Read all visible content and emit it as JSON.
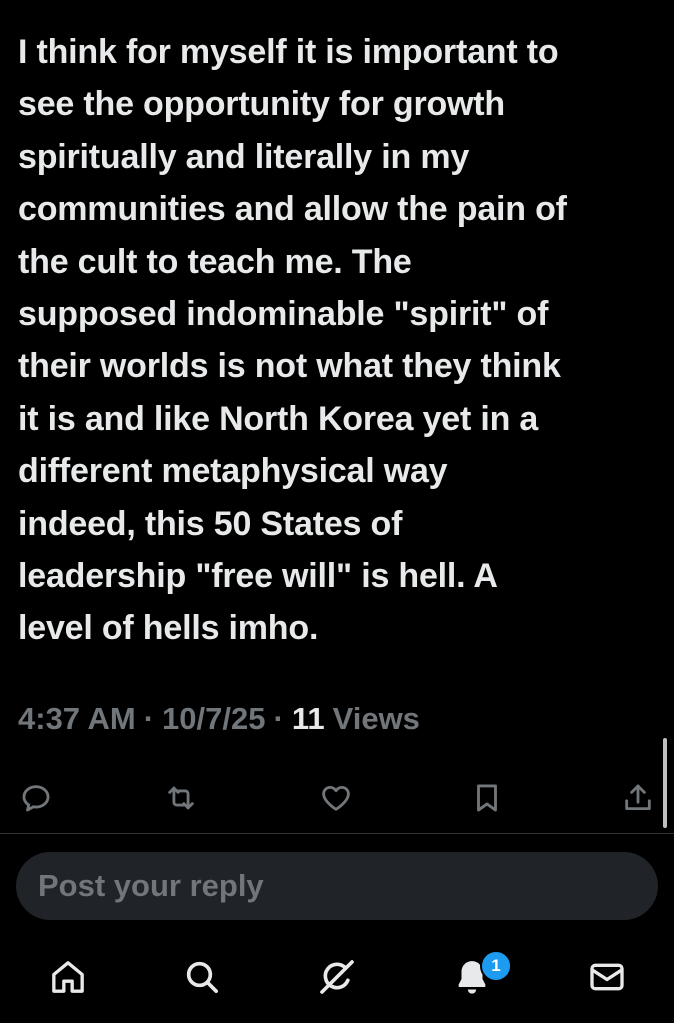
{
  "post": {
    "text": "I think for myself it is important to\nsee the opportunity for growth\nspiritually and literally in my\ncommunities and allow the pain of\nthe cult to teach me. The\nsupposed indominable \"spirit\" of\ntheir worlds is not what they think\nit is and like North Korea yet in a\ndifferent metaphysical way\nindeed, this 50 States of\nleadership \"free will\" is hell. A\nlevel of hells imho.",
    "time": "4:37 AM",
    "date": "10/7/25",
    "sep": "·",
    "views_count": "11",
    "views_label": "Views"
  },
  "actions": [
    {
      "name": "reply",
      "icon": "comment-icon"
    },
    {
      "name": "repost",
      "icon": "repost-icon"
    },
    {
      "name": "like",
      "icon": "heart-icon"
    },
    {
      "name": "bookmark",
      "icon": "bookmark-icon"
    },
    {
      "name": "share",
      "icon": "share-icon"
    }
  ],
  "reply_box": {
    "placeholder": "Post your reply"
  },
  "tabbar": {
    "items": [
      "home-icon",
      "search-icon",
      "grok-icon",
      "bell-icon",
      "mail-icon"
    ],
    "notifications_badge": "1"
  },
  "colors": {
    "background": "#000000",
    "text": "#e7e9ea",
    "muted": "#71767b",
    "accent": "#1d9bf0",
    "input": "#202327"
  }
}
